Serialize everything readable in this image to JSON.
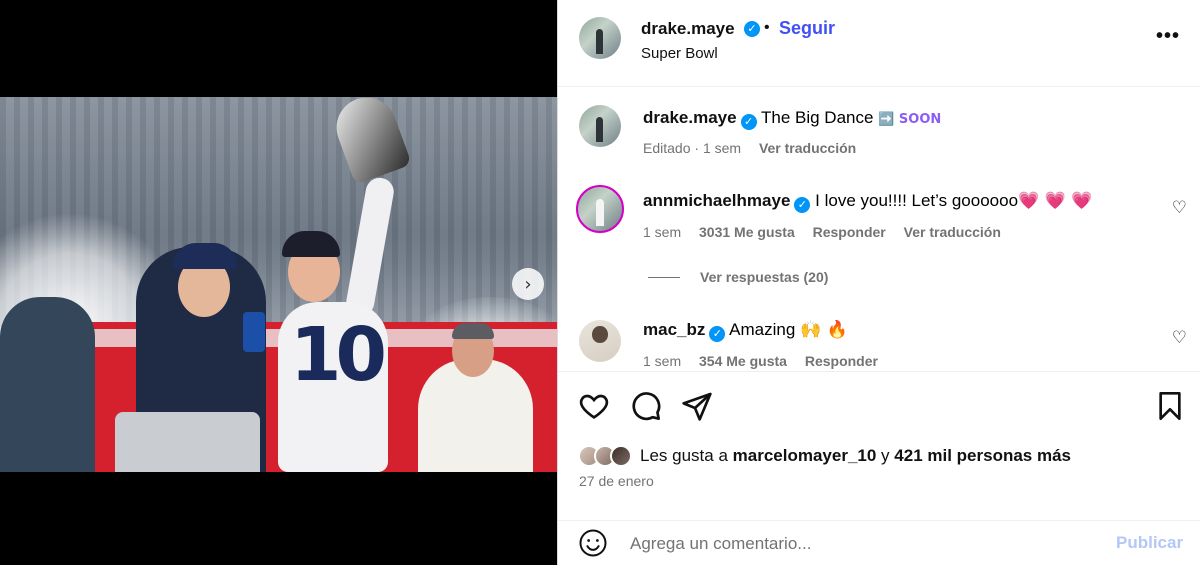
{
  "post": {
    "media": {
      "carousel_total": 3,
      "carousel_active": 1,
      "next_icon": "chevron-right-icon"
    },
    "header": {
      "username": "drake.maye",
      "verified_glyph": "✓",
      "separator": "•",
      "follow_label": "Seguir",
      "subtitle": "Super Bowl",
      "more_glyph": "•••"
    },
    "caption": {
      "username": "drake.maye",
      "text": "The Big Dance",
      "emoji": "➡️ SOON",
      "edited": "Editado",
      "time": "1 sem",
      "translate": "Ver traducción"
    },
    "comments": [
      {
        "username": "annmichaelhmaye",
        "text": "I love you!!!! Let’s goooooo",
        "hearts": "💗 💗 💗",
        "time": "1 sem",
        "likes": "3031 Me gusta",
        "reply": "Responder",
        "translate": "Ver traducción",
        "view_replies": "Ver respuestas (20)"
      },
      {
        "username": "mac_bz",
        "text": "Amazing",
        "emoji": "🙌 🔥",
        "time": "1 sem",
        "likes": "354 Me gusta",
        "reply": "Responder"
      }
    ],
    "actions": {
      "liked_by_prefix": "Les gusta a",
      "liked_by_user": "marcelomayer_10",
      "liked_by_and": "y",
      "liked_by_rest": "421 mil personas más",
      "date": "27 de enero"
    },
    "add_comment": {
      "placeholder": "Agrega un comentario...",
      "publish_label": "Publicar"
    }
  },
  "colors": {
    "accent": "#4150f7",
    "verified": "#0095f6",
    "muted": "#737373",
    "publish_disabled": "#b3c8f8"
  }
}
